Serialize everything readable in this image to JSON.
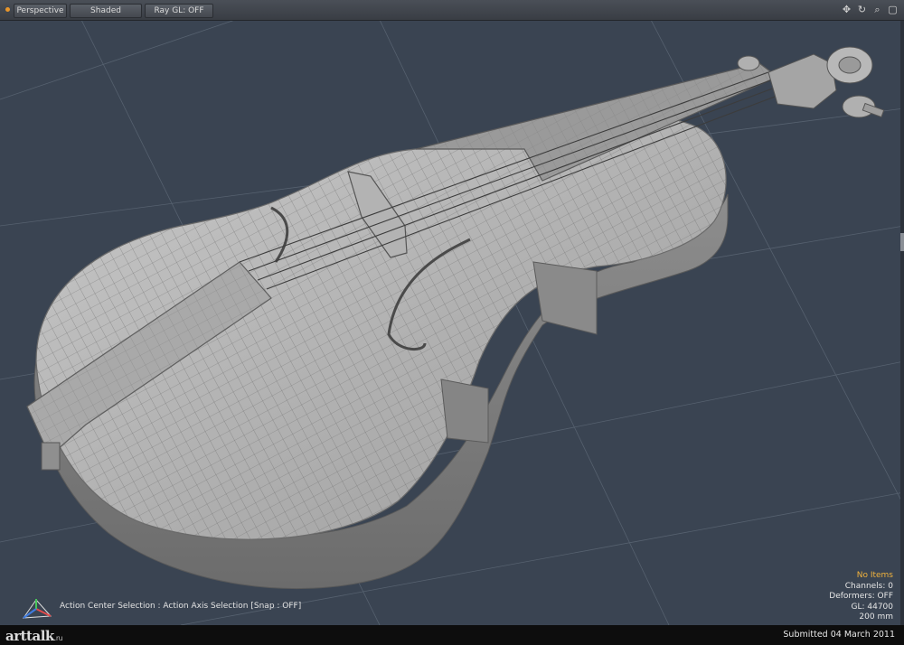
{
  "viewport": {
    "view_mode": "Perspective",
    "shading": "Shaded",
    "raygl": "Ray GL: OFF"
  },
  "nav_icons": [
    {
      "name": "move-view-icon",
      "glyph": "✥"
    },
    {
      "name": "rotate-view-icon",
      "glyph": "↻"
    },
    {
      "name": "zoom-view-icon",
      "glyph": "⌕"
    },
    {
      "name": "maximize-view-icon",
      "glyph": "▢"
    }
  ],
  "status": {
    "action": "Action Center Selection : Action Axis Selection",
    "snap": "[Snap : OFF]"
  },
  "info": {
    "items": "No Items",
    "channels": "Channels: 0",
    "deformers": "Deformers: OFF",
    "gl": "GL: 44700",
    "scale": "200 mm"
  },
  "footer": {
    "logo": "arttalk",
    "logo_suffix": ".ru",
    "submitted": "Submitted 04 March 2011"
  },
  "colors": {
    "viewport_bg": "#3a4452",
    "accent": "#e9962a",
    "info_highlight": "#f2b33d"
  }
}
